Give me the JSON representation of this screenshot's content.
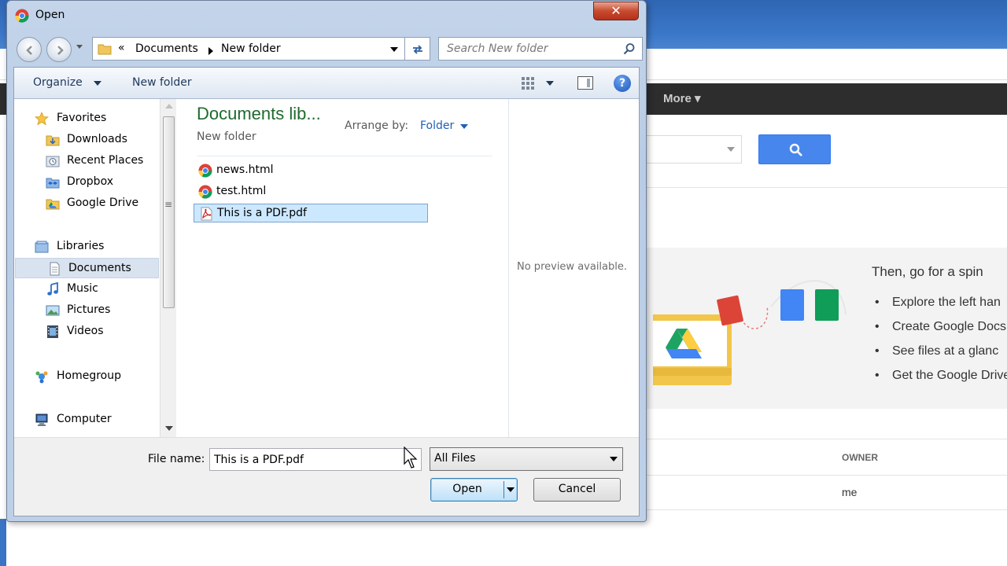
{
  "background_app": {
    "more_label": "More",
    "more_caret": "▾",
    "promo": {
      "title": "Then, go for a spin",
      "items": [
        "Explore the left han",
        "Create Google Docs",
        "See files at a glanc",
        "Get the Google Drive"
      ]
    },
    "table": {
      "owner_header": "OWNER",
      "owner_value": "me"
    },
    "colors": {
      "search_button": "#4787ed",
      "top_bar": "#2d2d2d"
    }
  },
  "dialog": {
    "title": "Open",
    "close_label": "✕",
    "address": {
      "chevron": "«",
      "crumbs": [
        "Documents",
        "New folder"
      ]
    },
    "search": {
      "placeholder": "Search New folder"
    },
    "toolbar": {
      "organize_label": "Organize",
      "new_folder_label": "New folder",
      "help_label": "?"
    },
    "nav": {
      "favorites": {
        "label": "Favorites",
        "items": [
          "Downloads",
          "Recent Places",
          "Dropbox",
          "Google Drive"
        ]
      },
      "libraries": {
        "label": "Libraries",
        "items": [
          "Documents",
          "Music",
          "Pictures",
          "Videos"
        ],
        "selected": "Documents"
      },
      "homegroup": "Homegroup",
      "computer": "Computer"
    },
    "library": {
      "title": "Documents lib...",
      "subtitle": "New folder",
      "arrange_label": "Arrange by:",
      "arrange_value": "Folder"
    },
    "files": [
      {
        "name": "news.html",
        "icon": "chrome-html-icon",
        "selected": false
      },
      {
        "name": "test.html",
        "icon": "chrome-html-icon",
        "selected": false
      },
      {
        "name": "This is a PDF.pdf",
        "icon": "pdf-file-icon",
        "selected": true
      }
    ],
    "preview_text": "No preview available.",
    "bottom": {
      "file_name_label": "File name:",
      "file_name_value": "This is a PDF.pdf",
      "filter_value": "All Files",
      "open_label": "Open",
      "cancel_label": "Cancel"
    }
  }
}
